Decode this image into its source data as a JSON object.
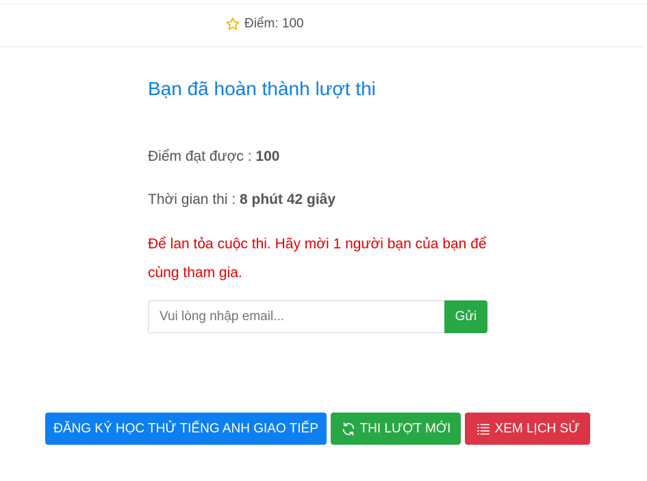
{
  "header": {
    "score_label": "Điểm: 100",
    "score_icon": "star-icon",
    "score_icon_color": "#f0b400"
  },
  "result": {
    "title": "Bạn đã hoàn thành lượt thi",
    "score_label": "Điểm đạt được : ",
    "score_value": "100",
    "time_label": "Thời gian thi : ",
    "time_value": "8 phút 42 giây",
    "invite_text": "Để lan tỏa cuộc thi. Hãy mời 1 người bạn của bạn để cùng tham gia."
  },
  "invite_form": {
    "email_placeholder": "Vui lòng nhập email...",
    "email_value": "",
    "send_label": "Gửi"
  },
  "actions": {
    "register_label": "ĐĂNG KÝ HỌC THỬ TIẾNG ANH GIAO TIẾP",
    "new_attempt_label": "THI LƯỢT MỚI",
    "new_attempt_icon": "refresh-icon",
    "history_label": "XEM LỊCH SỬ",
    "history_icon": "list-icon"
  },
  "colors": {
    "title": "#0d7fe6",
    "invite_text": "#e20000",
    "primary": "#0d7ff0",
    "success": "#28a745",
    "danger": "#dc3545"
  }
}
